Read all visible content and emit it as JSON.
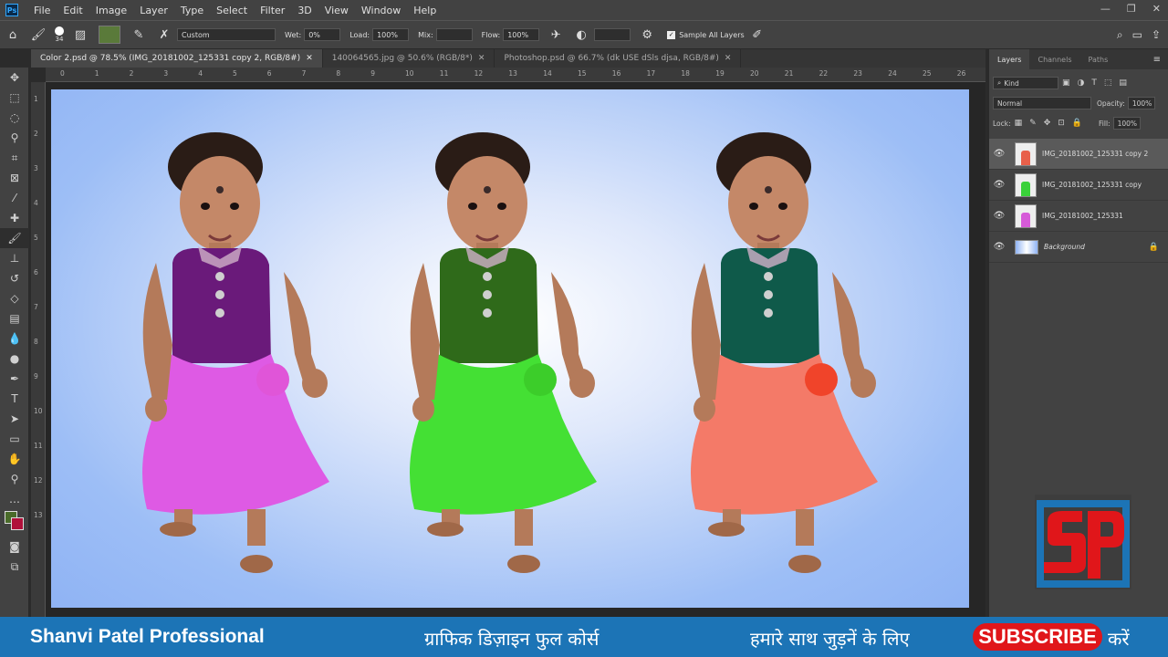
{
  "menubar": {
    "logo": "Ps",
    "items": [
      "File",
      "Edit",
      "Image",
      "Layer",
      "Type",
      "Select",
      "Filter",
      "3D",
      "View",
      "Window",
      "Help"
    ],
    "controls": [
      "—",
      "❐",
      "✕"
    ]
  },
  "options": {
    "brush_size": "34",
    "mode": "Custom",
    "wet_label": "Wet:",
    "wet_value": "0%",
    "load_label": "Load:",
    "load_value": "100%",
    "mix_label": "Mix:",
    "mix_value": "",
    "flow_label": "Flow:",
    "flow_value": "100%",
    "sample_all_label": "Sample All Layers"
  },
  "tabs": [
    {
      "label": "Color 2.psd @ 78.5% (IMG_20181002_125331 copy 2, RGB/8#)",
      "close": "✕"
    },
    {
      "label": "140064565.jpg @ 50.6% (RGB/8*)",
      "close": "✕"
    },
    {
      "label": "Photoshop.psd @ 66.7% (dk USE dSls djsa, RGB/8#)",
      "close": "✕"
    }
  ],
  "ruler_h": [
    "0",
    "1",
    "2",
    "3",
    "4",
    "5",
    "6",
    "7",
    "8",
    "9",
    "10",
    "11",
    "12",
    "13",
    "14",
    "15",
    "16",
    "17",
    "18",
    "19",
    "20",
    "21",
    "22",
    "23",
    "24",
    "25",
    "26"
  ],
  "ruler_v": [
    "1",
    "2",
    "3",
    "4",
    "5",
    "6",
    "7",
    "8",
    "9",
    "10",
    "11",
    "12",
    "13"
  ],
  "panel": {
    "tabs": [
      "Layers",
      "Channels",
      "Paths"
    ],
    "filter_kind": "Kind",
    "blend_mode": "Normal",
    "opacity_label": "Opacity:",
    "opacity_value": "100%",
    "lock_label": "Lock:",
    "fill_label": "Fill:",
    "fill_value": "100%",
    "layers": [
      {
        "name": "IMG_20181002_125331 copy 2",
        "color": "#e8604a",
        "selected": true
      },
      {
        "name": "IMG_20181002_125331 copy",
        "color": "#3ad13a",
        "selected": false
      },
      {
        "name": "IMG_20181002_125331",
        "color": "#d65ad8",
        "selected": false
      },
      {
        "name": "Background",
        "color": "#8fb3f4",
        "selected": false
      }
    ]
  },
  "figures": [
    {
      "top_color": "#6a1a7a",
      "dress_color": "#de5ae4",
      "flower_color": "#e055d8"
    },
    {
      "top_color": "#2f6a1a",
      "dress_color": "#44e034",
      "flower_color": "#3ccd2a"
    },
    {
      "top_color": "#0f5a4a",
      "dress_color": "#f47a68",
      "flower_color": "#f0442a"
    }
  ],
  "logo": {
    "letters": "SP",
    "red": "#e0161a",
    "blue": "#1c74b6"
  },
  "bottom": {
    "channel_name": "Shanvi Patel Professional",
    "course_text": "ग्राफिक डिज़ाइन फुल कोर्स",
    "join_text": "हमारे साथ जुड़नें के लिए",
    "subscribe_label": "SUBSCRIBE",
    "end_text": "करें"
  }
}
